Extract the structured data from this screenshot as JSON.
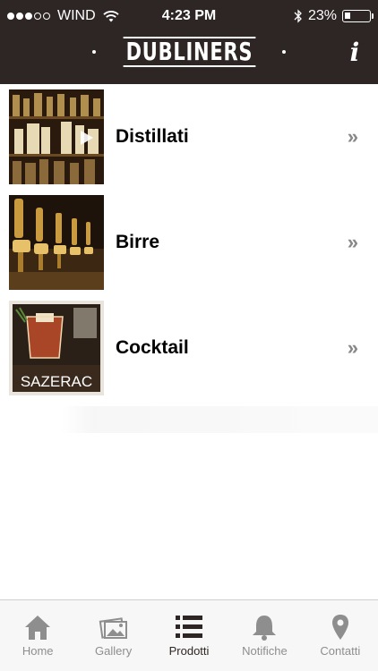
{
  "status_bar": {
    "carrier": "WIND",
    "time": "4:23 PM",
    "battery": "23%",
    "battery_level": 0.23,
    "signal_bars_filled": 3,
    "signal_bars_total": 5
  },
  "header": {
    "brand": "DUBLINERS",
    "info_label": "i",
    "background_color": "#2e2624"
  },
  "categories": [
    {
      "label": "Distillati",
      "chevron": "»",
      "thumbnail": "bottles-on-shelf"
    },
    {
      "label": "Birre",
      "chevron": "»",
      "thumbnail": "beer-taps"
    },
    {
      "label": "Cocktail",
      "chevron": "»",
      "thumbnail": "sazerac-glass",
      "thumbnail_caption": "SAZERAC"
    }
  ],
  "tab_bar": {
    "active_tab": "Prodotti",
    "tabs": [
      {
        "label": "Home",
        "icon": "home-icon"
      },
      {
        "label": "Gallery",
        "icon": "gallery-icon"
      },
      {
        "label": "Prodotti",
        "icon": "list-icon"
      },
      {
        "label": "Notifiche",
        "icon": "bell-icon"
      },
      {
        "label": "Contatti",
        "icon": "location-pin-icon"
      }
    ]
  }
}
